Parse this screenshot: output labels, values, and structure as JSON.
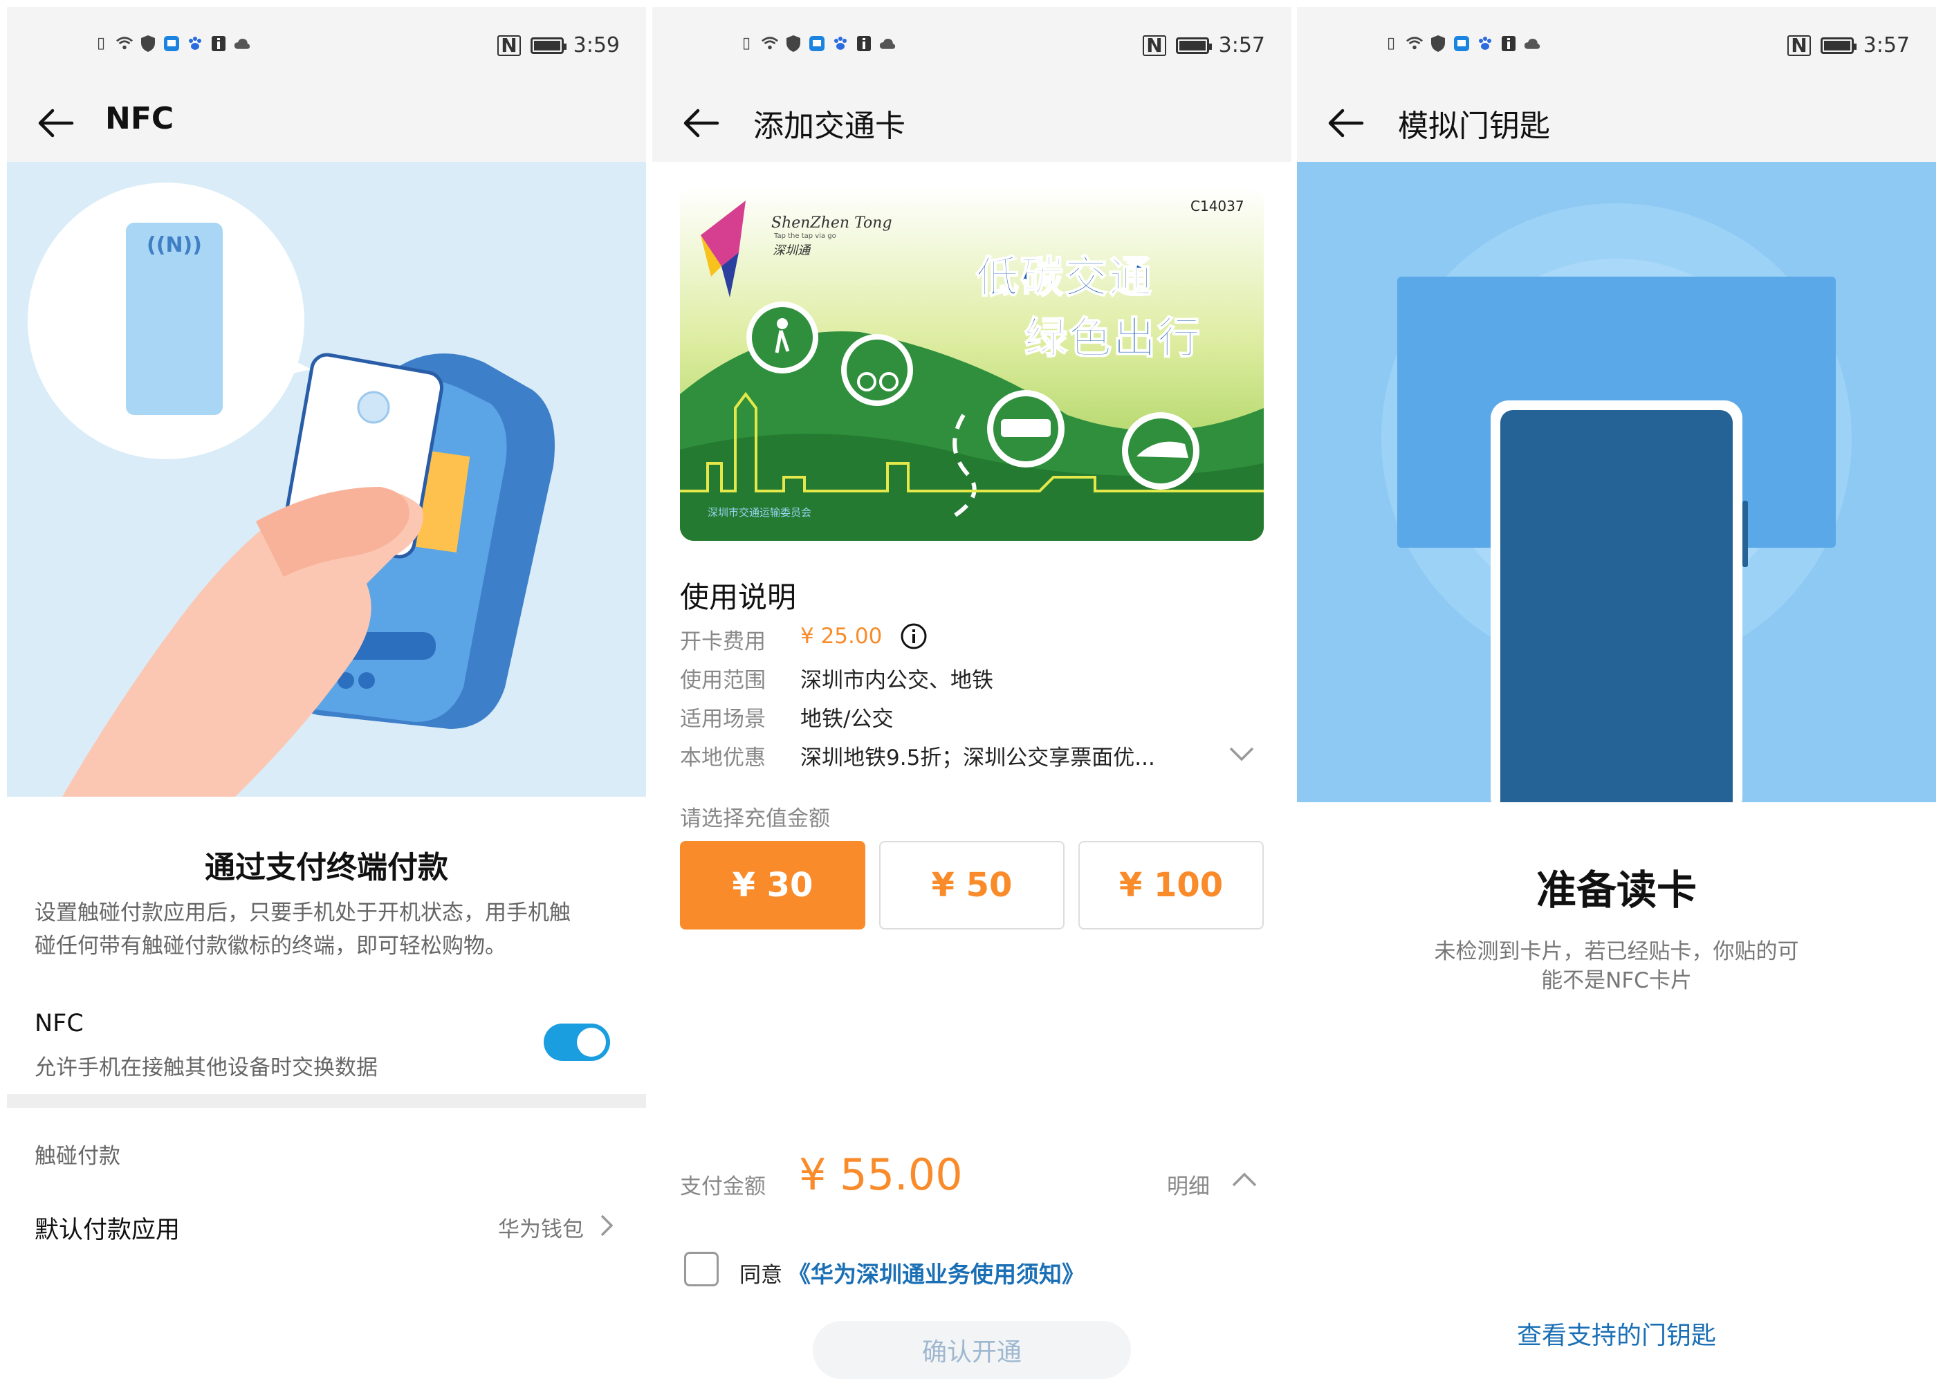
{
  "panel1": {
    "status_time": "3:59",
    "title": "NFC",
    "section_title": "通过支付终端付款",
    "section_desc_1": "设置触碰付款应用后，只要手机处于开机状态，用手机触",
    "section_desc_2": "碰任何带有触碰付款徽标的终端，即可轻松购物。",
    "nfc_label": "NFC",
    "nfc_sub": "允许手机在接触其他设备时交换数据",
    "nfc_enabled": true,
    "touch_pay_header": "触碰付款",
    "default_app_label": "默认付款应用",
    "default_app_value": "华为钱包"
  },
  "panel2": {
    "status_time": "3:57",
    "title": "添加交通卡",
    "card": {
      "serial": "C14037",
      "brand_script": "ShenZhen Tong",
      "brand_tagline": "Tap the tap via go",
      "brand_cn": "深圳通",
      "slogan_1": "低碳交通",
      "slogan_2": "绿色出行",
      "issuer": "深圳市交通运输委员会"
    },
    "usage_title": "使用说明",
    "info": [
      {
        "label": "开卡费用",
        "value": "¥ 25.00"
      },
      {
        "label": "使用范围",
        "value": "深圳市内公交、地铁"
      },
      {
        "label": "适用场景",
        "value": "地铁/公交"
      },
      {
        "label": "本地优惠",
        "value": "深圳地铁9.5折；深圳公交享票面优..."
      }
    ],
    "amount_prompt": "请选择充值金额",
    "amounts": [
      "¥ 30",
      "¥ 50",
      "¥ 100"
    ],
    "selected_amount_index": 0,
    "pay_label": "支付金额",
    "pay_value": "¥ 55.00",
    "detail_label": "明细",
    "agree_text": "同意",
    "agree_link": "《华为深圳通业务使用须知》",
    "confirm_label": "确认开通",
    "accent_color": "#f98b2a"
  },
  "panel3": {
    "status_time": "3:57",
    "title": "模拟门钥匙",
    "ready_title": "准备读卡",
    "ready_desc_1": "未检测到卡片，若已经贴卡，你贴的可",
    "ready_desc_2": "能不是NFC卡片",
    "link_label": "查看支持的门钥匙"
  }
}
